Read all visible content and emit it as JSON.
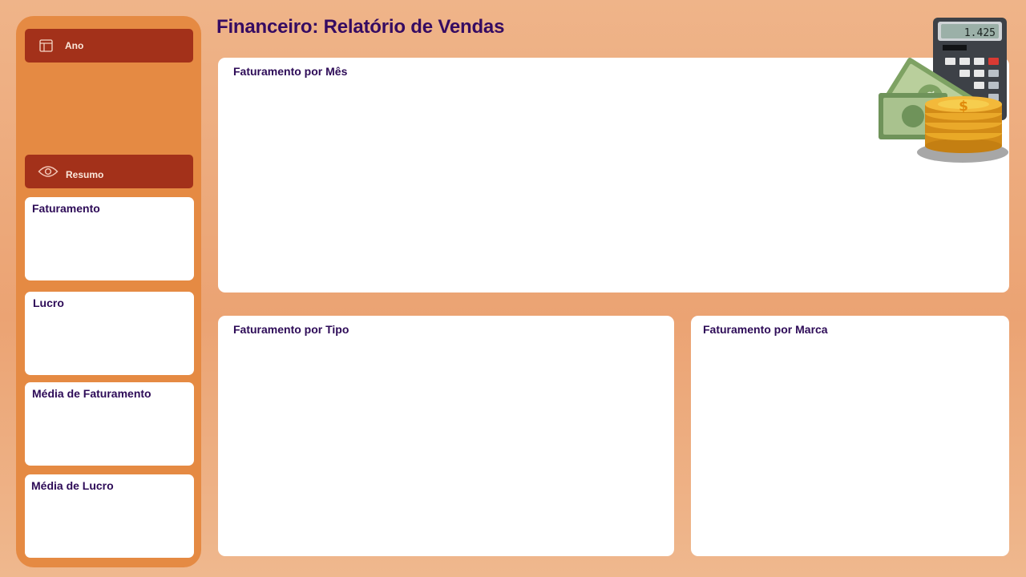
{
  "header": {
    "title": "Financeiro: Relatório de Vendas"
  },
  "sidebar": {
    "ano_button": {
      "label": "Ano",
      "icon": "table-layout-icon"
    },
    "resumo_button": {
      "label": "Resumo",
      "icon": "eye-icon"
    },
    "kpis": [
      {
        "title": "Faturamento"
      },
      {
        "title": "Lucro"
      },
      {
        "title": "Média de Faturamento"
      },
      {
        "title": "Média de Lucro"
      }
    ]
  },
  "panels": {
    "by_month": {
      "title": "Faturamento por Mês"
    },
    "by_type": {
      "title": "Faturamento por Tipo"
    },
    "by_brand": {
      "title": "Faturamento por Marca"
    }
  },
  "illustration": {
    "calculator_display": "1.425",
    "icon": "money-calculator-coins-icon"
  },
  "colors": {
    "background": "#eba373",
    "sidebar": "#e58a43",
    "button": "#a3311a",
    "title": "#350b62",
    "card": "#ffffff"
  }
}
